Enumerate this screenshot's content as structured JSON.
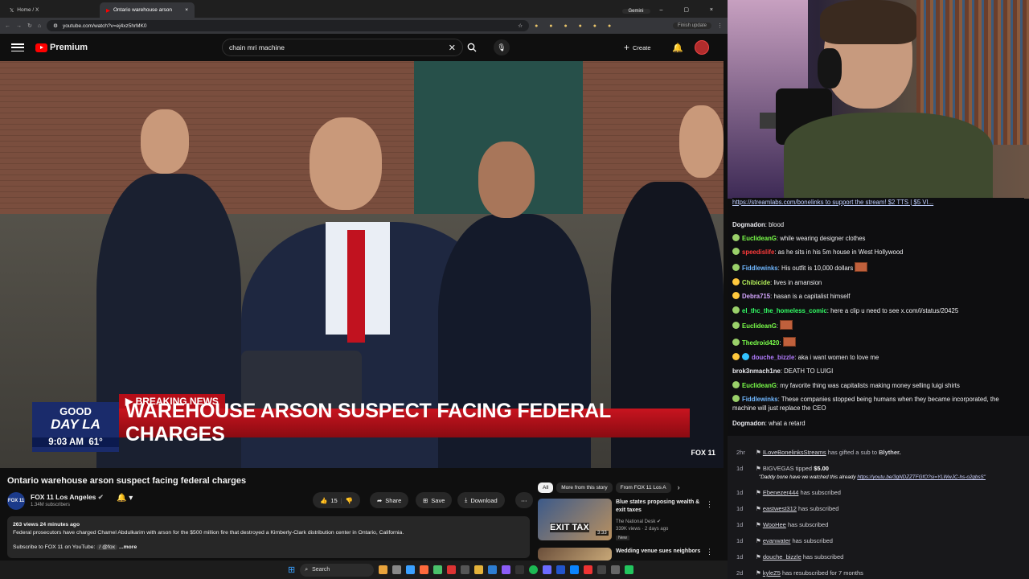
{
  "browser": {
    "tabs": [
      {
        "label": "Home / X"
      },
      {
        "label": "Ontario warehouse arson"
      }
    ],
    "url": "youtube.com/watch?v=ej4xz5hrMK0",
    "gemini_label": "Gemini",
    "update_label": "Finish update"
  },
  "youtube": {
    "logo_label": "Premium",
    "search_value": "chain mri machine",
    "create_label": "Create"
  },
  "video": {
    "lower_third": {
      "show_top": "GOOD",
      "show_bottom": "DAY LA",
      "time": "9:03 AM",
      "temp": "61°",
      "breaking": "BREAKING NEWS",
      "headline": "WAREHOUSE ARSON SUSPECT FACING FEDERAL CHARGES",
      "bug": "FOX 11"
    },
    "title": "Ontario warehouse arson suspect facing federal charges",
    "channel": {
      "name": "FOX 11 Los Angeles",
      "subscribers": "1.34M subscribers",
      "avatar_text": "FOX 11"
    },
    "actions": {
      "likes": "15",
      "share": "Share",
      "save": "Save",
      "download": "Download"
    },
    "description": {
      "stats": "263 views  24 minutes ago",
      "text": "Federal prosecutors have charged Chamel Abdulkarim with arson for the $500 million fire that destroyed a Kimberly-Clark distribution center in Ontario, California.",
      "subscribe_line": "Subscribe to FOX 11 on YouTube:",
      "link": "/ @fox",
      "more": "...more"
    }
  },
  "recommendations": {
    "chips": [
      "All",
      "More from this story",
      "From FOX 11 Los A"
    ],
    "items": [
      {
        "title": "Blue states proposing wealth & exit taxes",
        "channel": "The National Desk",
        "meta": "339K views · 2 days ago",
        "badge": "New",
        "thumb_text": "EXIT TAX",
        "duration": "3:33"
      },
      {
        "title": "Wedding venue sues neighbors",
        "channel": "",
        "meta": "",
        "badge": "",
        "thumb_text": "",
        "duration": ""
      }
    ]
  },
  "taskbar": {
    "search_placeholder": "Search"
  },
  "chat": {
    "pinned": "https://streamlabs.com/bonelinks to support the stream! $2 TTS | $5 VI...",
    "messages": [
      {
        "user": "Dogmadon",
        "text": "blood",
        "color": "#e9e9ee"
      },
      {
        "user": "EuclideanG",
        "text": "while wearing designer clothes",
        "color": "#7bff4a"
      },
      {
        "user": "speedislife",
        "text": "as he sits in his 5m house in West Hollywood",
        "color": "#ff3b3b"
      },
      {
        "user": "Fiddlewinks",
        "text": "His outfit is 10,000 dollars",
        "color": "#6fb7ff"
      },
      {
        "user": "Chibicide",
        "text": "lives in amansion",
        "color": "#b6f05a"
      },
      {
        "user": "Debra715",
        "text": "hasan is a capitalist himself",
        "color": "#d5a6ff"
      },
      {
        "user": "el_thc_the_homeless_comic",
        "text": "here a clip u need to see x.com/i/status/20425",
        "color": "#33ff66"
      },
      {
        "user": "EuclideanG",
        "text": "",
        "color": "#7bff4a"
      },
      {
        "user": "Thedroid420",
        "text": "",
        "color": "#7bff4a"
      },
      {
        "user": "douche_bizzle",
        "text": "aka i want women to love me",
        "color": "#b27cff"
      },
      {
        "user": "brok3nmach1ne",
        "text": "DEATH TO LUIGI",
        "color": "#e9e9ee"
      },
      {
        "user": "EuclideanG",
        "text": "my favorite thing was capitalists making money selling luigi shirts",
        "color": "#7bff4a"
      },
      {
        "user": "Fiddlewinks",
        "text": "These companies stopped being humans when they became incorporated, the machine will just replace the CEO",
        "color": "#6fb7ff"
      },
      {
        "user": "Dogmadon",
        "text": "what a retard",
        "color": "#e9e9ee"
      }
    ]
  },
  "events": [
    {
      "age": "2hr",
      "name": "ILoveBonelinksStreams",
      "text": "has gifted a sub to",
      "target": "Blyther."
    },
    {
      "age": "1d",
      "name": "BIGVEGAS",
      "text": "tipped",
      "amount": "$5.00",
      "quote": "\"Daddy bone have we watched this already",
      "link": "https://youtu.be/3gNDZZTFGfO?si=YLWwJC-hs-o2gbsS\""
    },
    {
      "age": "1d",
      "name": "Ebenezer444",
      "text": "has subscribed"
    },
    {
      "age": "1d",
      "name": "eastwest312",
      "text": "has subscribed"
    },
    {
      "age": "1d",
      "name": "WooHee",
      "text": "has subscribed"
    },
    {
      "age": "1d",
      "name": "evanwater",
      "text": "has subscribed"
    },
    {
      "age": "1d",
      "name": "douche_bizzle",
      "text": "has subscribed"
    },
    {
      "age": "2d",
      "name": "kyleZ5",
      "text": "has resubscribed for 7 months"
    }
  ]
}
